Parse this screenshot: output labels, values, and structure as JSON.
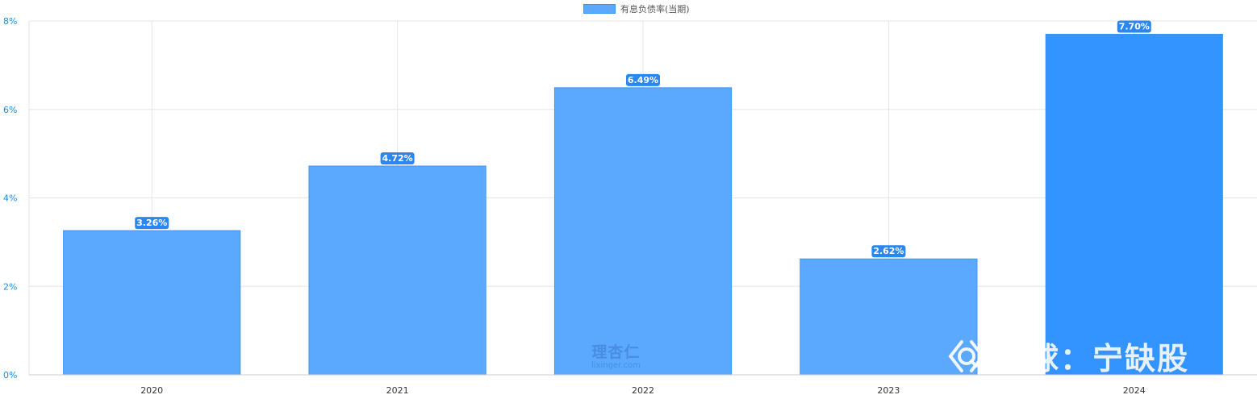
{
  "legend": {
    "label": "有息负债率(当期)"
  },
  "watermarks": {
    "lixinger_zh": "理杏仁",
    "lixinger_en": "lixinger.com",
    "xueqiu": "雪球：宁缺股"
  },
  "colors": {
    "bar": "#5ba8ff",
    "bar_highlight": "#3393ff",
    "label_bg": "#2a86f0",
    "axis_text": "#1a8ae6",
    "grid": "#e6e6e6"
  },
  "chart_data": {
    "type": "bar",
    "categories": [
      "2020",
      "2021",
      "2022",
      "2023",
      "2024"
    ],
    "series": [
      {
        "name": "有息负债率(当期)",
        "values": [
          3.26,
          4.72,
          6.49,
          2.62,
          7.7
        ]
      }
    ],
    "data_labels": [
      "3.26%",
      "4.72%",
      "6.49%",
      "2.62%",
      "7.70%"
    ],
    "y_ticks": [
      "0%",
      "2%",
      "4%",
      "6%",
      "8%"
    ],
    "ylim": [
      0,
      8
    ],
    "grid": true,
    "legend_position": "top-center",
    "highlight_index": 4
  }
}
